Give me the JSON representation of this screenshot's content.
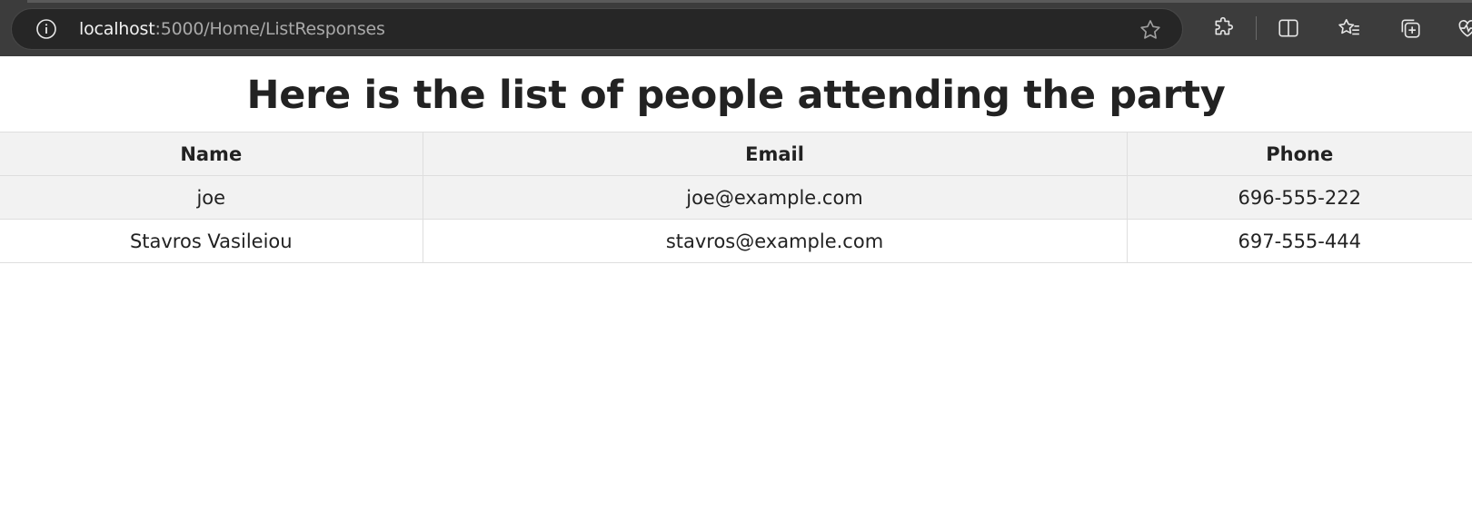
{
  "browser": {
    "url_host": "localhost",
    "url_path": ":5000/Home/ListResponses",
    "toolbar_icons": [
      "puzzle-icon",
      "split-screen-icon",
      "favorites-icon",
      "collections-icon",
      "health-icon"
    ]
  },
  "page": {
    "title": "Here is the list of people attending the party"
  },
  "table": {
    "headers": {
      "name": "Name",
      "email": "Email",
      "phone": "Phone"
    },
    "rows": [
      {
        "name": "joe",
        "email": "joe@example.com",
        "phone": "696-555-222"
      },
      {
        "name": "Stavros Vasileiou",
        "email": "stavros@example.com",
        "phone": "697-555-444"
      }
    ]
  },
  "colors": {
    "browser_chrome": "#3c3c3c",
    "address_bar": "#262626",
    "header_row": "#f2f2f2",
    "text": "#222222"
  }
}
